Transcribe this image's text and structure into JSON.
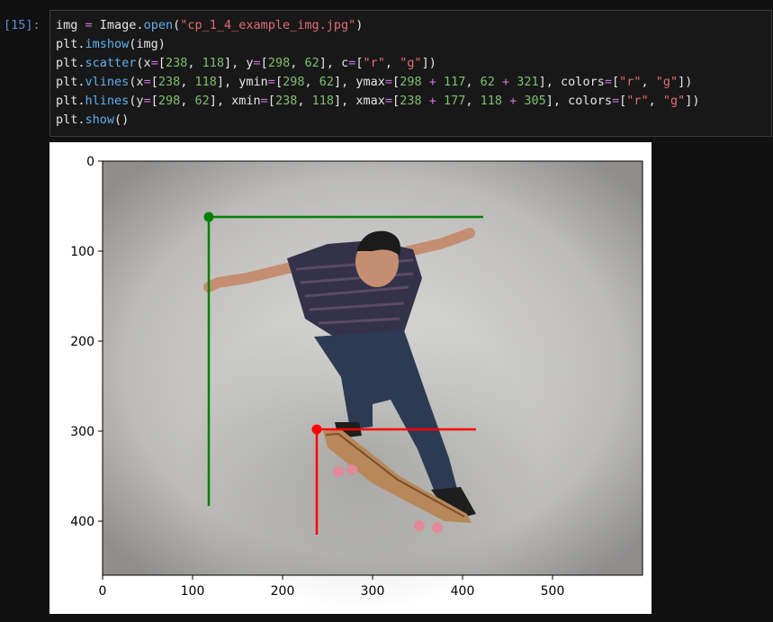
{
  "cell": {
    "prompt": "[15]:",
    "lines": [
      [
        {
          "t": "img",
          "c": "#e6e6e6"
        },
        {
          "t": " = ",
          "c": "#c678dd"
        },
        {
          "t": "Image.",
          "c": "#e6e6e6"
        },
        {
          "t": "open",
          "c": "#61afef"
        },
        {
          "t": "(",
          "c": "#e6e6e6"
        },
        {
          "t": "\"cp_1_4_example_img.jpg\"",
          "c": "#e06c75"
        },
        {
          "t": ")",
          "c": "#e6e6e6"
        }
      ],
      [
        {
          "t": "plt.",
          "c": "#e6e6e6"
        },
        {
          "t": "imshow",
          "c": "#61afef"
        },
        {
          "t": "(img)",
          "c": "#e6e6e6"
        }
      ],
      [
        {
          "t": "plt.",
          "c": "#e6e6e6"
        },
        {
          "t": "scatter",
          "c": "#61afef"
        },
        {
          "t": "(x",
          "c": "#e6e6e6"
        },
        {
          "t": "=",
          "c": "#c678dd"
        },
        {
          "t": "[",
          "c": "#e6e6e6"
        },
        {
          "t": "238",
          "c": "#7fbf6f"
        },
        {
          "t": ", ",
          "c": "#e6e6e6"
        },
        {
          "t": "118",
          "c": "#7fbf6f"
        },
        {
          "t": "], y",
          "c": "#e6e6e6"
        },
        {
          "t": "=",
          "c": "#c678dd"
        },
        {
          "t": "[",
          "c": "#e6e6e6"
        },
        {
          "t": "298",
          "c": "#7fbf6f"
        },
        {
          "t": ", ",
          "c": "#e6e6e6"
        },
        {
          "t": "62",
          "c": "#7fbf6f"
        },
        {
          "t": "], c",
          "c": "#e6e6e6"
        },
        {
          "t": "=",
          "c": "#c678dd"
        },
        {
          "t": "[",
          "c": "#e6e6e6"
        },
        {
          "t": "\"r\"",
          "c": "#e06c75"
        },
        {
          "t": ", ",
          "c": "#e6e6e6"
        },
        {
          "t": "\"g\"",
          "c": "#e06c75"
        },
        {
          "t": "])",
          "c": "#e6e6e6"
        }
      ],
      [
        {
          "t": "plt.",
          "c": "#e6e6e6"
        },
        {
          "t": "vlines",
          "c": "#61afef"
        },
        {
          "t": "(x",
          "c": "#e6e6e6"
        },
        {
          "t": "=",
          "c": "#c678dd"
        },
        {
          "t": "[",
          "c": "#e6e6e6"
        },
        {
          "t": "238",
          "c": "#7fbf6f"
        },
        {
          "t": ", ",
          "c": "#e6e6e6"
        },
        {
          "t": "118",
          "c": "#7fbf6f"
        },
        {
          "t": "], ymin",
          "c": "#e6e6e6"
        },
        {
          "t": "=",
          "c": "#c678dd"
        },
        {
          "t": "[",
          "c": "#e6e6e6"
        },
        {
          "t": "298",
          "c": "#7fbf6f"
        },
        {
          "t": ", ",
          "c": "#e6e6e6"
        },
        {
          "t": "62",
          "c": "#7fbf6f"
        },
        {
          "t": "], ymax",
          "c": "#e6e6e6"
        },
        {
          "t": "=",
          "c": "#c678dd"
        },
        {
          "t": "[",
          "c": "#e6e6e6"
        },
        {
          "t": "298",
          "c": "#7fbf6f"
        },
        {
          "t": " + ",
          "c": "#c678dd"
        },
        {
          "t": "117",
          "c": "#7fbf6f"
        },
        {
          "t": ", ",
          "c": "#e6e6e6"
        },
        {
          "t": "62",
          "c": "#7fbf6f"
        },
        {
          "t": " + ",
          "c": "#c678dd"
        },
        {
          "t": "321",
          "c": "#7fbf6f"
        },
        {
          "t": "], colors",
          "c": "#e6e6e6"
        },
        {
          "t": "=",
          "c": "#c678dd"
        },
        {
          "t": "[",
          "c": "#e6e6e6"
        },
        {
          "t": "\"r\"",
          "c": "#e06c75"
        },
        {
          "t": ", ",
          "c": "#e6e6e6"
        },
        {
          "t": "\"g\"",
          "c": "#e06c75"
        },
        {
          "t": "])",
          "c": "#e6e6e6"
        }
      ],
      [
        {
          "t": "plt.",
          "c": "#e6e6e6"
        },
        {
          "t": "hlines",
          "c": "#61afef"
        },
        {
          "t": "(y",
          "c": "#e6e6e6"
        },
        {
          "t": "=",
          "c": "#c678dd"
        },
        {
          "t": "[",
          "c": "#e6e6e6"
        },
        {
          "t": "298",
          "c": "#7fbf6f"
        },
        {
          "t": ", ",
          "c": "#e6e6e6"
        },
        {
          "t": "62",
          "c": "#7fbf6f"
        },
        {
          "t": "], xmin",
          "c": "#e6e6e6"
        },
        {
          "t": "=",
          "c": "#c678dd"
        },
        {
          "t": "[",
          "c": "#e6e6e6"
        },
        {
          "t": "238",
          "c": "#7fbf6f"
        },
        {
          "t": ", ",
          "c": "#e6e6e6"
        },
        {
          "t": "118",
          "c": "#7fbf6f"
        },
        {
          "t": "], xmax",
          "c": "#e6e6e6"
        },
        {
          "t": "=",
          "c": "#c678dd"
        },
        {
          "t": "[",
          "c": "#e6e6e6"
        },
        {
          "t": "238",
          "c": "#7fbf6f"
        },
        {
          "t": " + ",
          "c": "#c678dd"
        },
        {
          "t": "177",
          "c": "#7fbf6f"
        },
        {
          "t": ", ",
          "c": "#e6e6e6"
        },
        {
          "t": "118",
          "c": "#7fbf6f"
        },
        {
          "t": " + ",
          "c": "#c678dd"
        },
        {
          "t": "305",
          "c": "#7fbf6f"
        },
        {
          "t": "], colors",
          "c": "#e6e6e6"
        },
        {
          "t": "=",
          "c": "#c678dd"
        },
        {
          "t": "[",
          "c": "#e6e6e6"
        },
        {
          "t": "\"r\"",
          "c": "#e06c75"
        },
        {
          "t": ", ",
          "c": "#e6e6e6"
        },
        {
          "t": "\"g\"",
          "c": "#e06c75"
        },
        {
          "t": "])",
          "c": "#e6e6e6"
        }
      ],
      [
        {
          "t": "plt.",
          "c": "#e6e6e6"
        },
        {
          "t": "show",
          "c": "#61afef"
        },
        {
          "t": "()",
          "c": "#e6e6e6"
        }
      ]
    ]
  },
  "chart_data": {
    "type": "scatter",
    "image": "skateboarder photo",
    "xlim": [
      0,
      600
    ],
    "ylim": [
      460,
      0
    ],
    "xticks": [
      0,
      100,
      200,
      300,
      400,
      500
    ],
    "yticks": [
      0,
      100,
      200,
      300,
      400
    ],
    "points": [
      {
        "x": 238,
        "y": 298,
        "color": "#ff0000"
      },
      {
        "x": 118,
        "y": 62,
        "color": "#008000"
      }
    ],
    "vlines": [
      {
        "x": 238,
        "ymin": 298,
        "ymax": 415,
        "color": "#ff0000"
      },
      {
        "x": 118,
        "ymin": 62,
        "ymax": 383,
        "color": "#008000"
      }
    ],
    "hlines": [
      {
        "y": 298,
        "xmin": 238,
        "xmax": 415,
        "color": "#ff0000"
      },
      {
        "y": 62,
        "xmin": 118,
        "xmax": 423,
        "color": "#008000"
      }
    ]
  }
}
